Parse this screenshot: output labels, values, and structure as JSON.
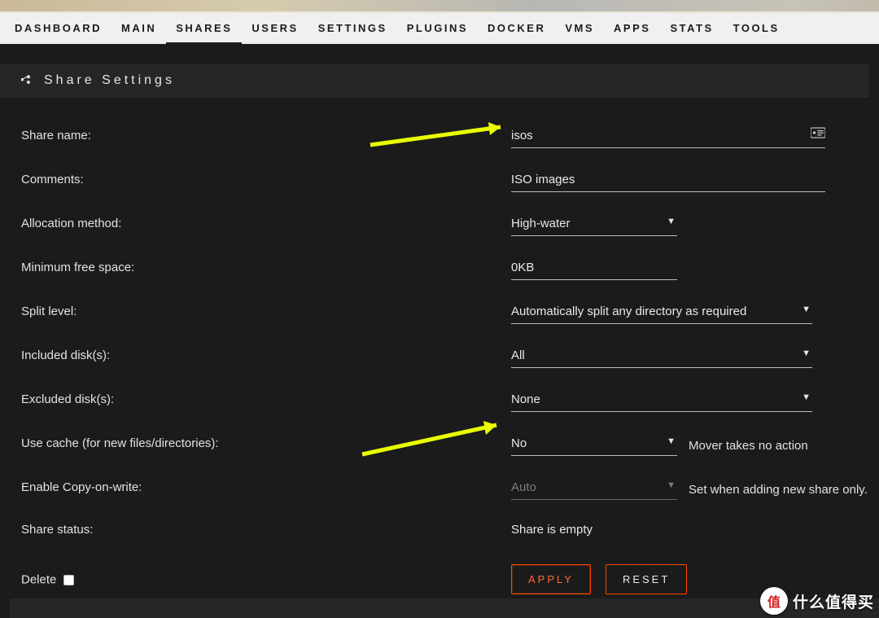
{
  "nav": {
    "items": [
      "DASHBOARD",
      "MAIN",
      "SHARES",
      "USERS",
      "SETTINGS",
      "PLUGINS",
      "DOCKER",
      "VMS",
      "APPS",
      "STATS",
      "TOOLS"
    ],
    "active_index": 2
  },
  "section": {
    "title": "Share Settings",
    "icon": "share-icon"
  },
  "form": {
    "share_name": {
      "label": "Share name:",
      "value": "isos"
    },
    "comments": {
      "label": "Comments:",
      "value": "ISO images"
    },
    "allocation_method": {
      "label": "Allocation method:",
      "value": "High-water"
    },
    "min_free": {
      "label": "Minimum free space:",
      "value": "0KB"
    },
    "split_level": {
      "label": "Split level:",
      "value": "Automatically split any directory as required"
    },
    "included_disks": {
      "label": "Included disk(s):",
      "value": "All"
    },
    "excluded_disks": {
      "label": "Excluded disk(s):",
      "value": "None"
    },
    "use_cache": {
      "label": "Use cache (for new files/directories):",
      "value": "No",
      "note": "Mover takes no action"
    },
    "cow": {
      "label": "Enable Copy-on-write:",
      "value": "Auto",
      "note": "Set when adding new share only."
    },
    "status": {
      "label": "Share status:",
      "value": "Share is empty"
    },
    "delete": {
      "label": "Delete"
    }
  },
  "buttons": {
    "apply": "APPLY",
    "reset": "RESET"
  },
  "watermark": {
    "badge": "值",
    "text": "什么值得买"
  }
}
